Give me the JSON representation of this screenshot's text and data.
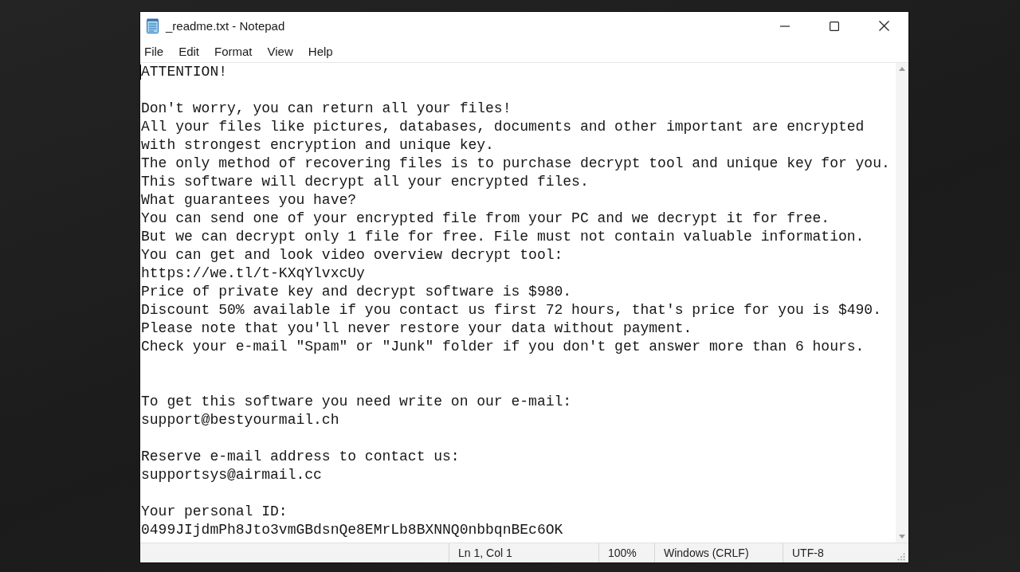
{
  "window": {
    "title": "_readme.txt - Notepad"
  },
  "menu": [
    "File",
    "Edit",
    "Format",
    "View",
    "Help"
  ],
  "document": {
    "lines": [
      {
        "kind": "text",
        "text": "ATTENTION!"
      },
      {
        "kind": "blank"
      },
      {
        "kind": "text",
        "text": "Don't worry, you can return all your files!"
      },
      {
        "kind": "text",
        "text": "All your files like pictures, databases, documents and other important are encrypted"
      },
      {
        "kind": "text",
        "text": "with strongest encryption and unique key."
      },
      {
        "kind": "text",
        "text": "The only method of recovering files is to purchase decrypt tool and unique key for you."
      },
      {
        "kind": "text",
        "text": "This software will decrypt all your encrypted files."
      },
      {
        "kind": "text",
        "text": "What guarantees you have?"
      },
      {
        "kind": "text",
        "text": "You can send one of your encrypted file from your PC and we decrypt it for free."
      },
      {
        "kind": "text",
        "text": "But we can decrypt only 1 file for free. File must not contain valuable information."
      },
      {
        "kind": "text",
        "text": "You can get and look video overview decrypt tool:"
      },
      {
        "kind": "text",
        "text": "https://we.tl/t-KXqYlvxcUy"
      },
      {
        "kind": "text",
        "text": "Price of private key and decrypt software is $980."
      },
      {
        "kind": "text",
        "text": "Discount 50% available if you contact us first 72 hours, that's price for you is $490."
      },
      {
        "kind": "text",
        "text": "Please note that you'll never restore your data without payment."
      },
      {
        "kind": "text",
        "text": "Check your e-mail \"Spam\" or \"Junk\" folder if you don't get answer more than 6 hours."
      },
      {
        "kind": "blank"
      },
      {
        "kind": "blank"
      },
      {
        "kind": "text",
        "text": "To get this software you need write on our e-mail:"
      },
      {
        "kind": "text",
        "text": "support@bestyourmail.ch"
      },
      {
        "kind": "blank"
      },
      {
        "kind": "text",
        "text": "Reserve e-mail address to contact us:"
      },
      {
        "kind": "text",
        "text": "supportsys@airmail.cc"
      },
      {
        "kind": "blank"
      },
      {
        "kind": "text",
        "text": "Your personal ID:"
      },
      {
        "kind": "text",
        "text": "0499JIjdmPh8Jto3vmGBdsnQe8EMrLb8BXNNQ0nbbqnBEc6OK"
      }
    ]
  },
  "status_bar": {
    "position": "Ln 1, Col 1",
    "zoom": "100%",
    "line_endings": "Windows (CRLF)",
    "encoding": "UTF-8"
  }
}
